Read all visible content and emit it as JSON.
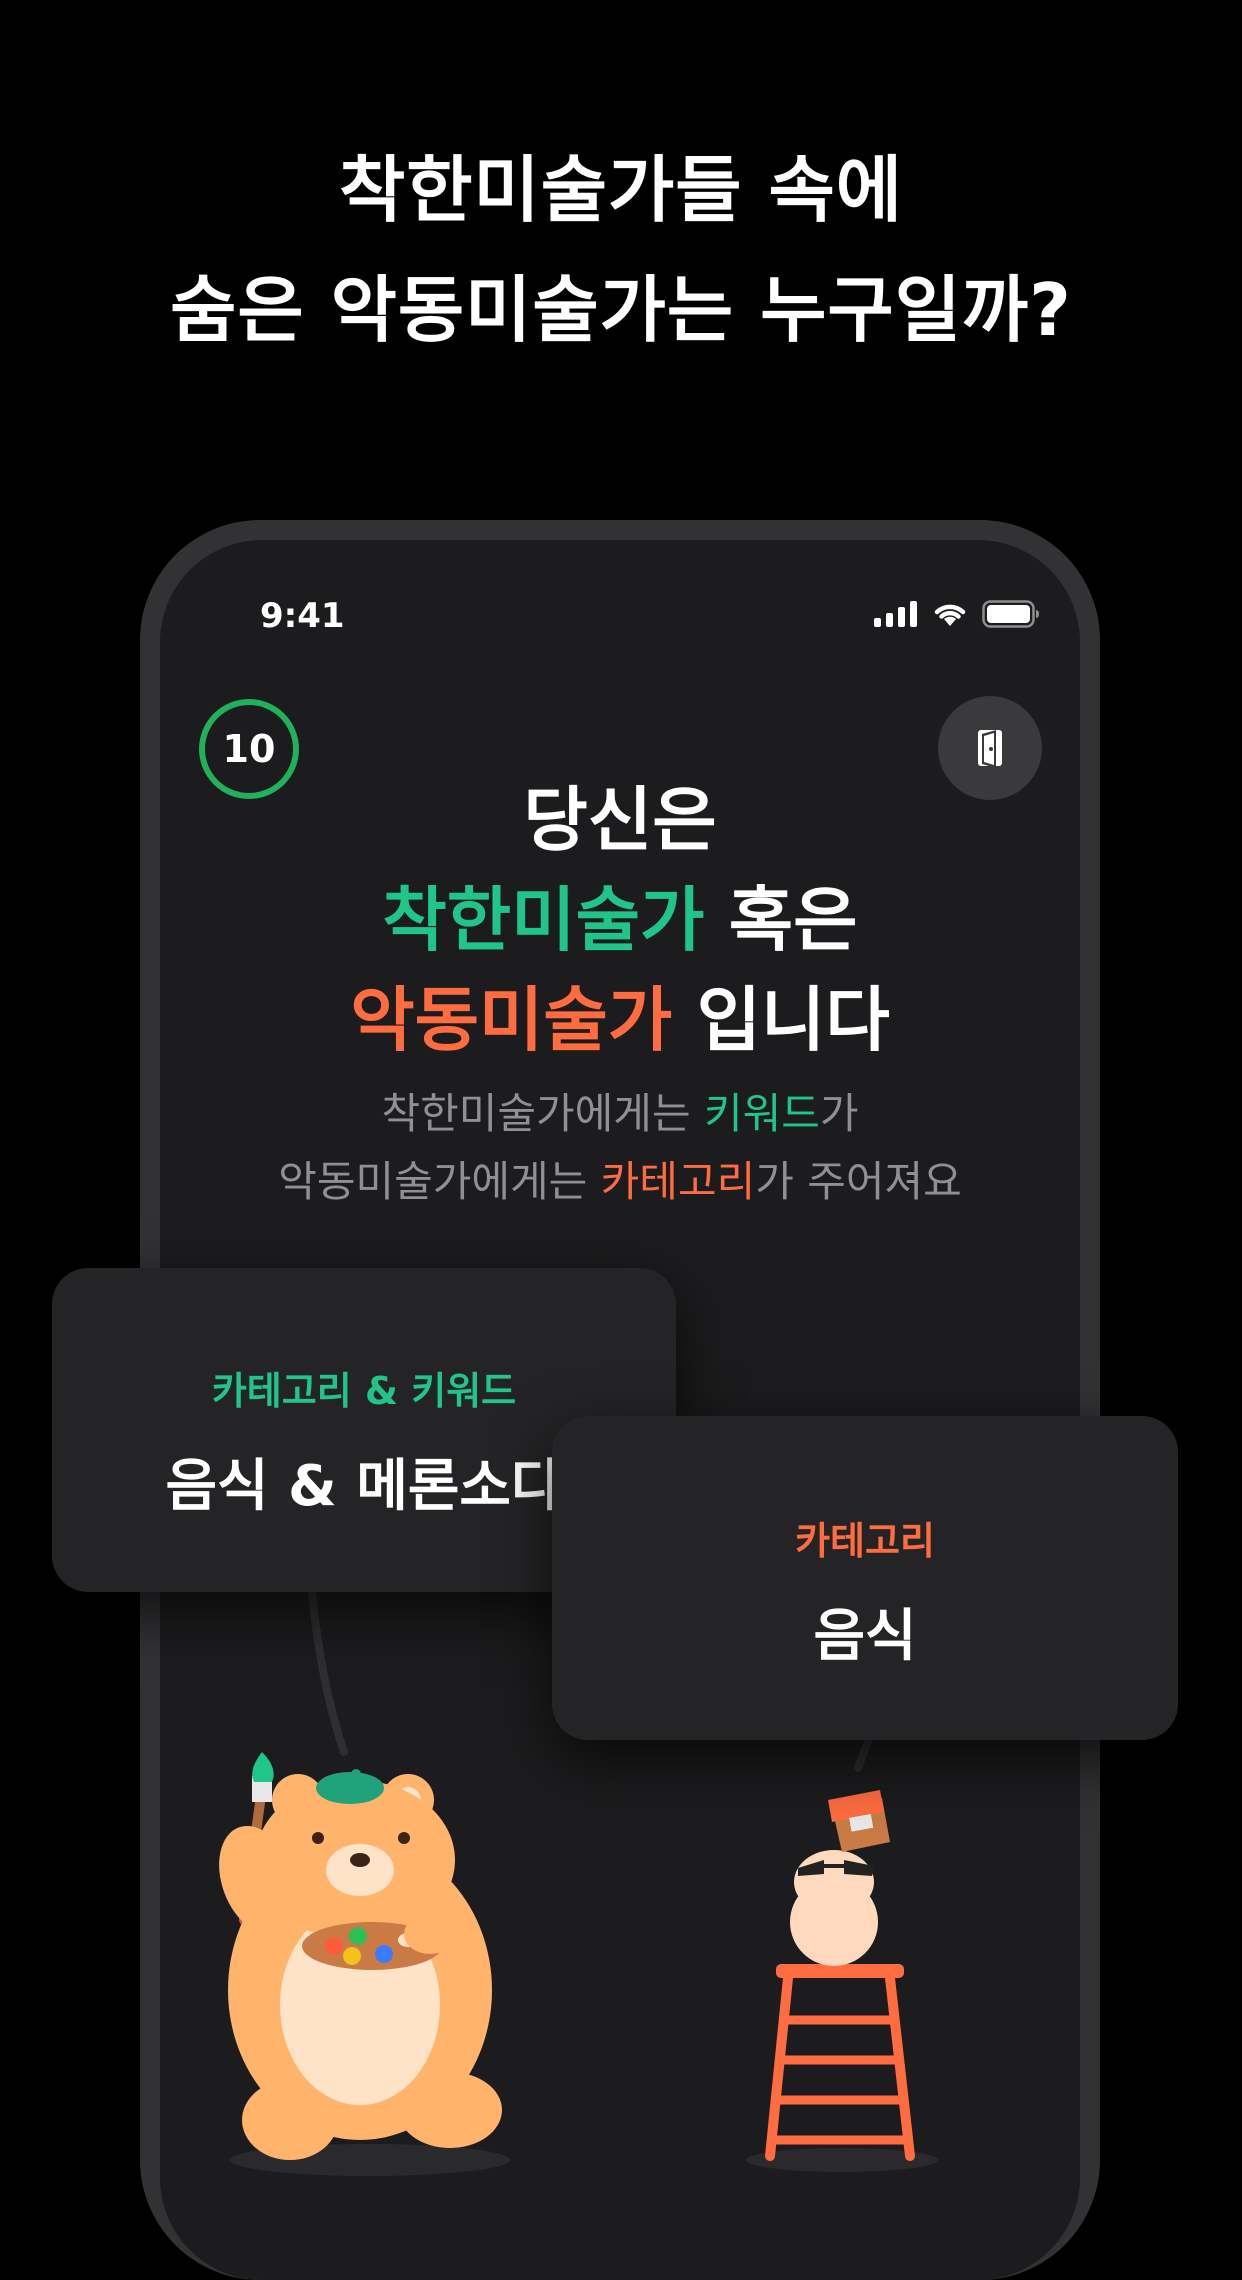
{
  "headline": {
    "line1": "착한미술가들 속에",
    "line2": "숨은 악동미술가는 누구일까?"
  },
  "status_bar": {
    "time": "9:41"
  },
  "timer": {
    "value": "10",
    "color": "#20b15a"
  },
  "exit_button": {
    "icon": "door-exit-icon"
  },
  "intro": {
    "line1": "당신은",
    "good_role": "착한미술가",
    "or_word": " 혹은",
    "bad_role": "악동미술가",
    "is_word": " 입니다"
  },
  "description": {
    "line1_prefix": "착한미술가에게는 ",
    "line1_highlight": "키워드",
    "line1_suffix": "가",
    "line2_prefix": "악동미술가에게는 ",
    "line2_highlight": "카테고리",
    "line2_suffix": "가 주어져요"
  },
  "good_card": {
    "label": "카테고리 & 키워드",
    "value": "음식 & 메론소다"
  },
  "bad_card": {
    "label": "카테고리",
    "value": "음식"
  },
  "colors": {
    "good": "#20c58a",
    "bad": "#ff6c40",
    "background": "#000000",
    "screen": "#1c1c1e",
    "card": "#242426"
  }
}
